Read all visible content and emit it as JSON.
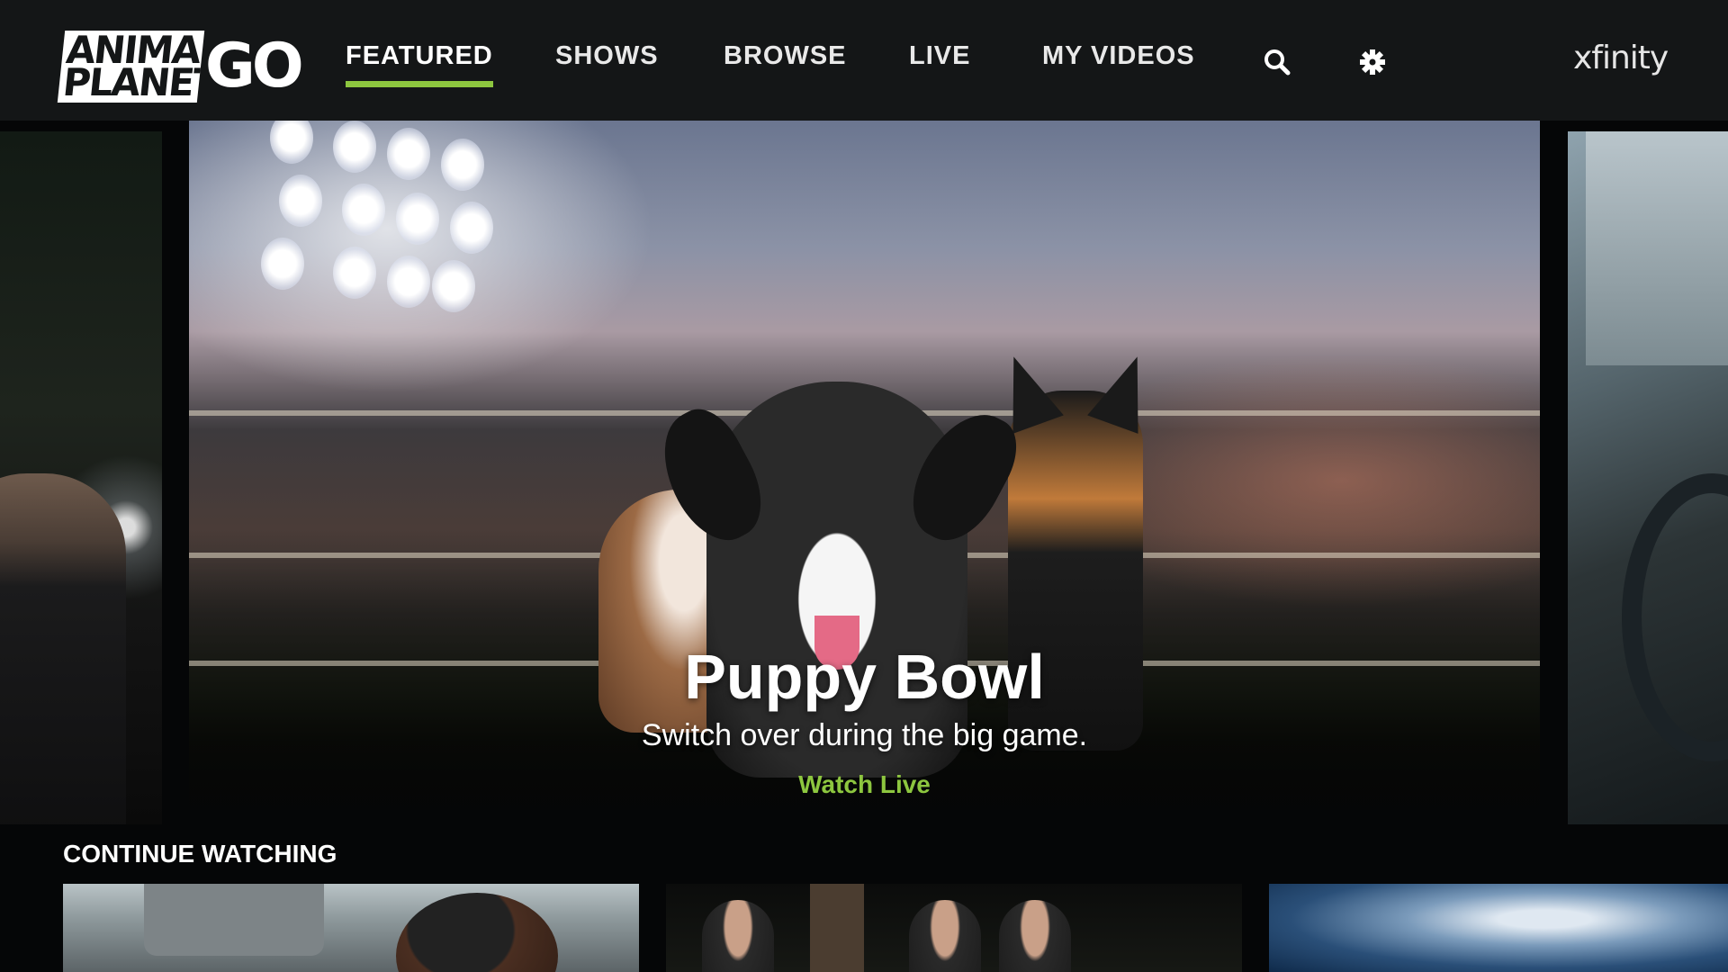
{
  "logo": {
    "line1": "ANIMAL",
    "line2": "PLANET",
    "suffix": "GO"
  },
  "nav": {
    "items": [
      {
        "label": "FEATURED",
        "active": true
      },
      {
        "label": "SHOWS",
        "active": false
      },
      {
        "label": "BROWSE",
        "active": false
      },
      {
        "label": "LIVE",
        "active": false
      },
      {
        "label": "MY VIDEOS",
        "active": false
      }
    ],
    "search_icon": "search-icon",
    "settings_icon": "gear-icon",
    "brand": "xfinity",
    "accent": "#8dc63f"
  },
  "hero": {
    "title": "Puppy Bowl",
    "subtitle": "Switch over during the big game.",
    "cta": "Watch Live"
  },
  "continue_watching": {
    "title": "CONTINUE WATCHING"
  }
}
